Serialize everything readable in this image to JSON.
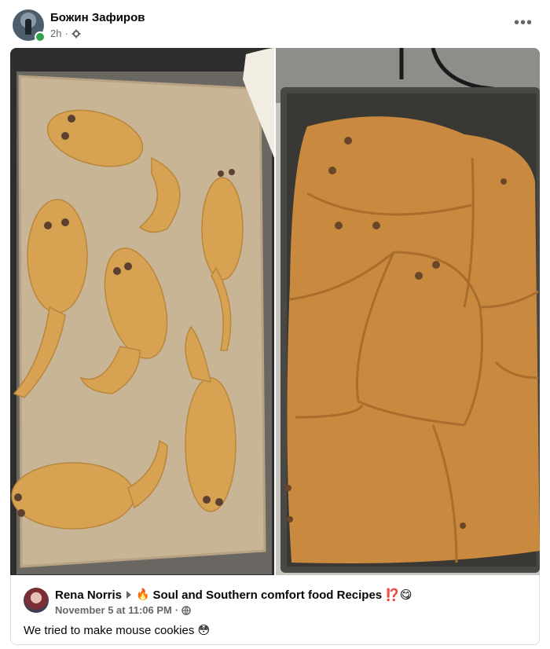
{
  "post": {
    "author": "Божин Зафиров",
    "time": "2h",
    "separator": "·",
    "audience_icon": "gear-icon",
    "more_label": "•••"
  },
  "photos": [
    {
      "description_icon": "photo-raw-dough-mice"
    },
    {
      "description_icon": "photo-baked-cookie-sheet"
    }
  ],
  "shared": {
    "author": "Rena Norris",
    "group": "Soul and Southern comfort food Recipes",
    "group_suffix": "⁉️😋",
    "fire_emoji": "🔥",
    "date": "November 5 at 11:06 PM",
    "separator": "·",
    "audience_icon": "globe-icon",
    "text": "We tried to make mouse cookies",
    "text_emoji": "😳"
  },
  "colors": {
    "online": "#31a24c",
    "meta_text": "#65676b",
    "dough": "#d9a85a",
    "parchment": "#c9b79a"
  }
}
